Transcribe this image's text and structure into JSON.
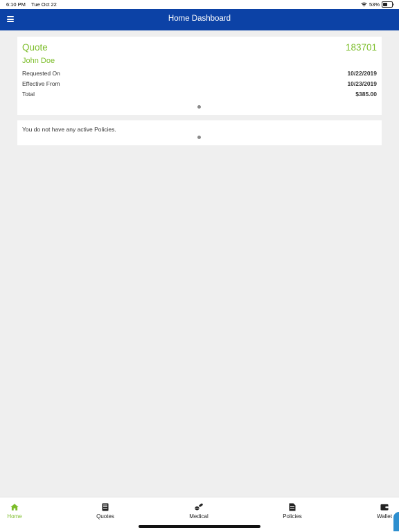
{
  "status_bar": {
    "time": "6:10 PM",
    "date": "Tue Oct 22",
    "battery_percent": "53%",
    "battery_level": 0.53,
    "icons": [
      "wifi-icon",
      "battery-icon"
    ]
  },
  "nav": {
    "title": "Home Dashboard",
    "menu_icon": "hamburger-menu-icon",
    "background": "#0c42a6"
  },
  "quote_card": {
    "title": "Quote",
    "number": "183701",
    "customer": "John Doe",
    "rows": [
      {
        "label": "Requested On",
        "value": "10/22/2019"
      },
      {
        "label": "Effective From",
        "value": "10/23/2019"
      },
      {
        "label": "Total",
        "value": "$385.00"
      }
    ],
    "accent_color": "#7cbd2a"
  },
  "policies_card": {
    "message": "You do not have any active Policies."
  },
  "tabs": [
    {
      "label": "Home",
      "icon": "home-icon",
      "active": true
    },
    {
      "label": "Quotes",
      "icon": "document-icon",
      "active": false
    },
    {
      "label": "Medical",
      "icon": "pills-icon",
      "active": false
    },
    {
      "label": "Policies",
      "icon": "file-icon",
      "active": false
    },
    {
      "label": "Wallet",
      "icon": "wallet-icon",
      "active": false
    }
  ],
  "colors": {
    "active_tab": "#7cbd2a",
    "background": "#efefef"
  }
}
